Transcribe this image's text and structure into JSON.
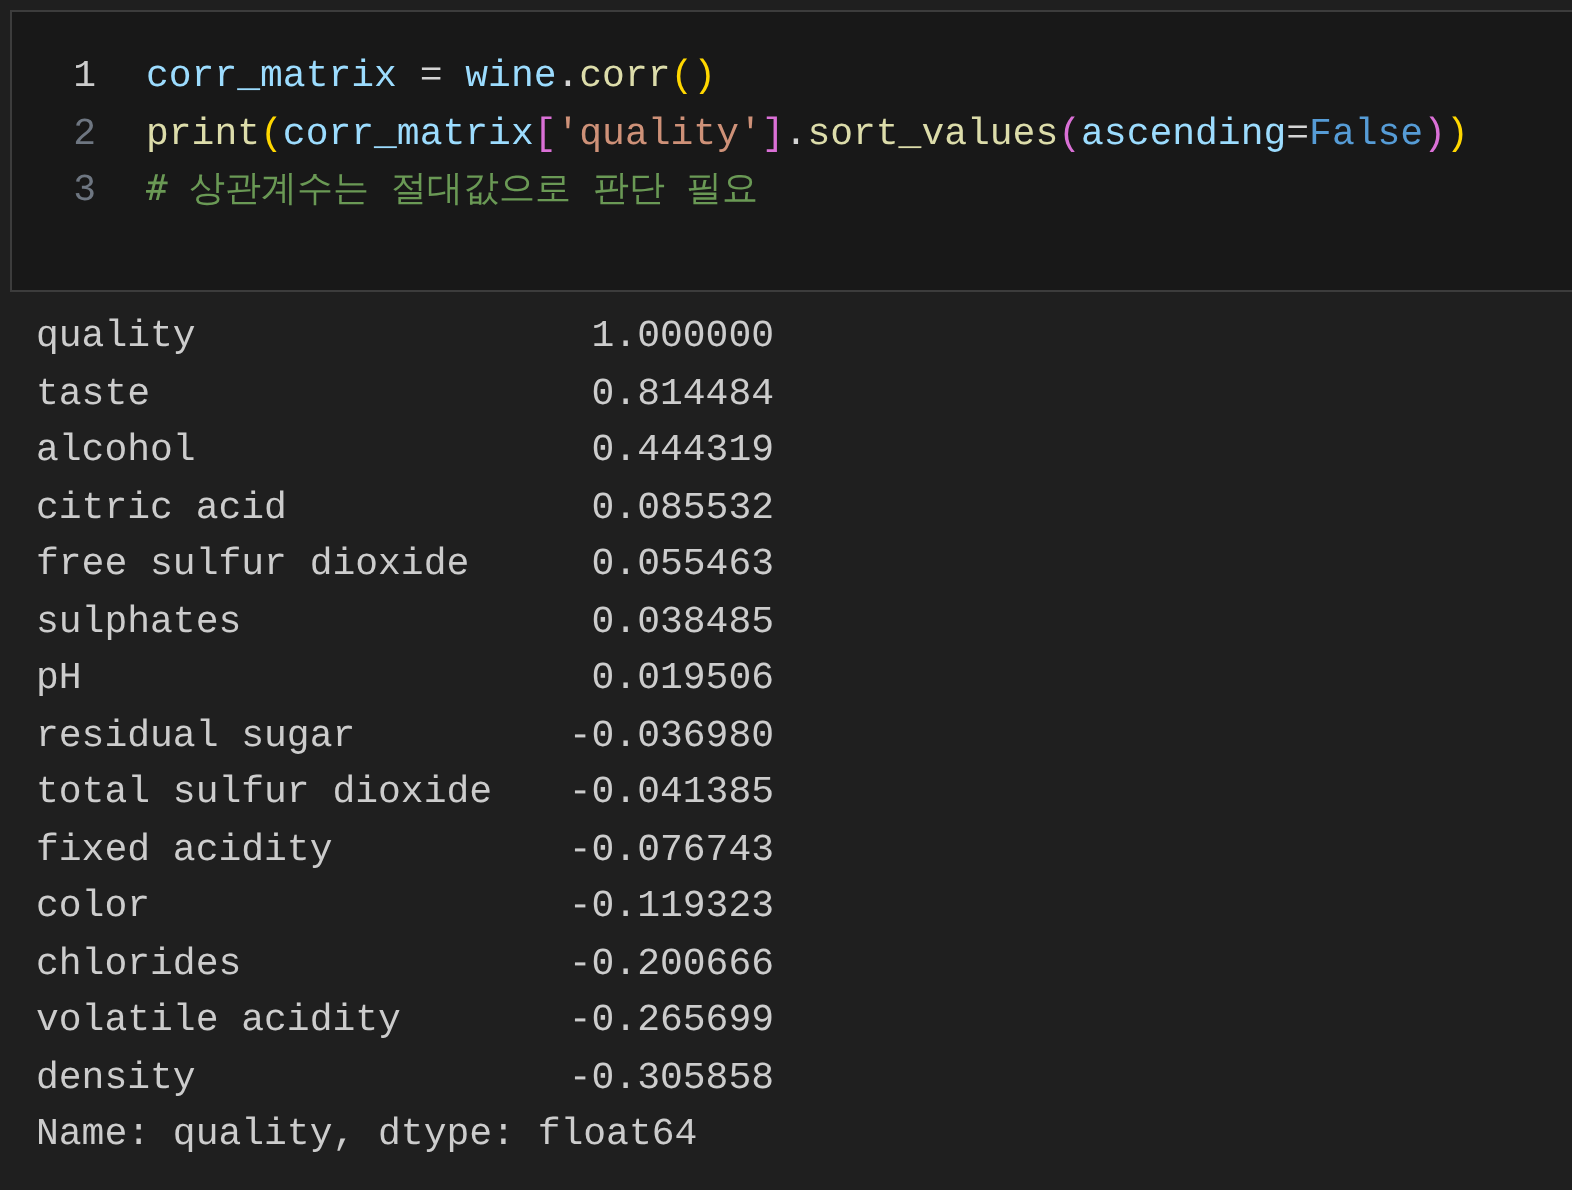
{
  "code_cell": {
    "lines": [
      {
        "number": "1",
        "active": true,
        "tokens": [
          {
            "kind": "variable",
            "text": "corr_matrix"
          },
          {
            "kind": "operator",
            "text": " = "
          },
          {
            "kind": "variable",
            "text": "wine"
          },
          {
            "kind": "operator",
            "text": "."
          },
          {
            "kind": "function",
            "text": "corr"
          },
          {
            "kind": "bracket1",
            "text": "()"
          }
        ]
      },
      {
        "number": "2",
        "active": false,
        "tokens": [
          {
            "kind": "function",
            "text": "print"
          },
          {
            "kind": "bracket1",
            "text": "("
          },
          {
            "kind": "variable",
            "text": "corr_matrix"
          },
          {
            "kind": "bracket2",
            "text": "["
          },
          {
            "kind": "string",
            "text": "'quality'"
          },
          {
            "kind": "bracket2",
            "text": "]"
          },
          {
            "kind": "operator",
            "text": "."
          },
          {
            "kind": "function",
            "text": "sort_values"
          },
          {
            "kind": "bracket2",
            "text": "("
          },
          {
            "kind": "variable",
            "text": "ascending"
          },
          {
            "kind": "operator",
            "text": "="
          },
          {
            "kind": "constant",
            "text": "False"
          },
          {
            "kind": "bracket2",
            "text": ")"
          },
          {
            "kind": "bracket1",
            "text": ")"
          }
        ]
      },
      {
        "number": "3",
        "active": false,
        "tokens": [
          {
            "kind": "comment",
            "text": "# 상관계수는 절대값으로 판단 필요"
          }
        ]
      }
    ]
  },
  "output": {
    "rows": [
      {
        "name": "quality",
        "value": "1.000000"
      },
      {
        "name": "taste",
        "value": "0.814484"
      },
      {
        "name": "alcohol",
        "value": "0.444319"
      },
      {
        "name": "citric acid",
        "value": "0.085532"
      },
      {
        "name": "free sulfur dioxide",
        "value": "0.055463"
      },
      {
        "name": "sulphates",
        "value": "0.038485"
      },
      {
        "name": "pH",
        "value": "0.019506"
      },
      {
        "name": "residual sugar",
        "value": "-0.036980"
      },
      {
        "name": "total sulfur dioxide",
        "value": "-0.041385"
      },
      {
        "name": "fixed acidity",
        "value": "-0.076743"
      },
      {
        "name": "color",
        "value": "-0.119323"
      },
      {
        "name": "chlorides",
        "value": "-0.200666"
      },
      {
        "name": "volatile acidity",
        "value": "-0.265699"
      },
      {
        "name": "density",
        "value": "-0.305858"
      }
    ],
    "footer": "Name: quality, dtype: float64"
  }
}
